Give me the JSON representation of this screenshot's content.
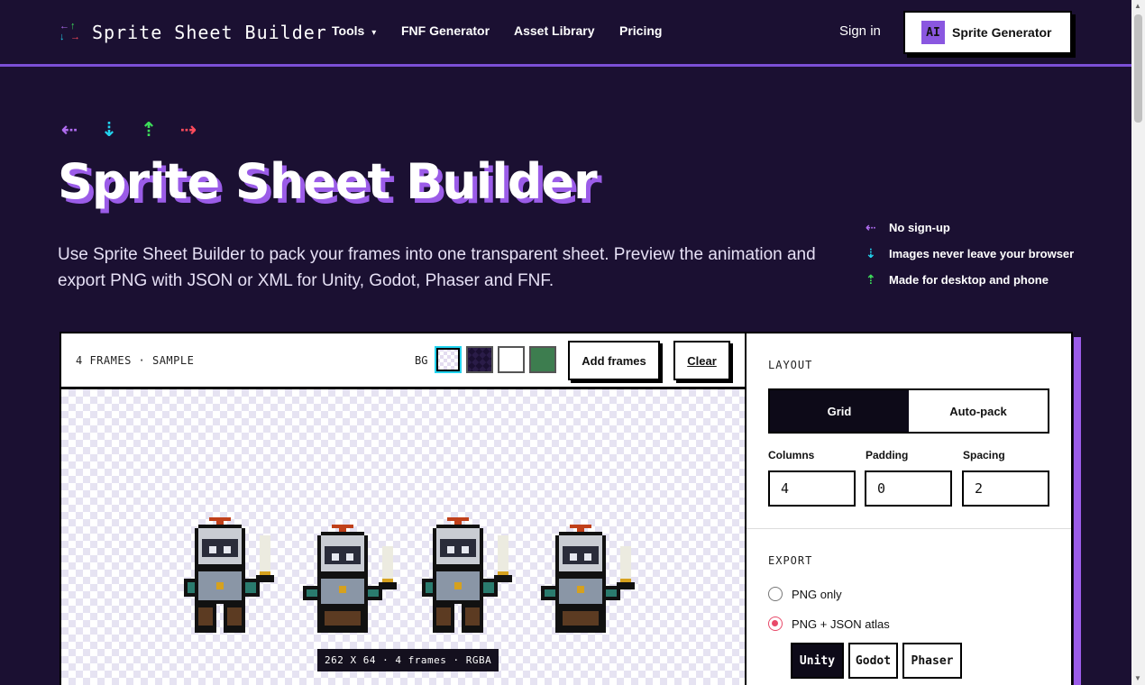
{
  "nav": {
    "logo_text": "Sprite Sheet Builder",
    "links": [
      {
        "label": "Tools",
        "dropdown": true
      },
      {
        "label": "FNF Generator"
      },
      {
        "label": "Asset Library"
      },
      {
        "label": "Pricing"
      }
    ],
    "dropdown_caret": "▾",
    "sign_in": "Sign in",
    "cta_badge": "AI",
    "cta_label": "Sprite Generator"
  },
  "hero": {
    "arrows": [
      {
        "glyph": "⇠",
        "icon": "left-arrow-icon",
        "color": "#b06cf0"
      },
      {
        "glyph": "⇣",
        "icon": "down-arrow-icon",
        "color": "#22d3ee"
      },
      {
        "glyph": "⇡",
        "icon": "up-arrow-icon",
        "color": "#3ddc5a"
      },
      {
        "glyph": "⇢",
        "icon": "right-arrow-icon",
        "color": "#ff4b5c"
      }
    ],
    "title": "Sprite Sheet Builder",
    "description": "Use Sprite Sheet Builder to pack your frames into one transparent sheet. Preview the animation and export PNG with JSON or XML for Unity, Godot, Phaser and FNF.",
    "features": [
      {
        "glyph": "⇠",
        "icon": "left-arrow-icon",
        "color": "#b06cf0",
        "text": "No sign-up"
      },
      {
        "glyph": "⇣",
        "icon": "down-arrow-icon",
        "color": "#22d3ee",
        "text": "Images never leave your browser"
      },
      {
        "glyph": "⇡",
        "icon": "up-arrow-icon",
        "color": "#3ddc5a",
        "text": "Made for desktop and phone"
      }
    ]
  },
  "tool": {
    "frames_label": "4 FRAMES · SAMPLE",
    "bg_label": "BG",
    "bg_swatches": [
      {
        "name": "checker",
        "color": "#efeaf7",
        "selected": true
      },
      {
        "name": "dark",
        "color": "#1b1032",
        "selected": false
      },
      {
        "name": "white",
        "color": "#ffffff",
        "selected": false
      },
      {
        "name": "green",
        "color": "#3d7d4f",
        "selected": false
      }
    ],
    "add_frames": "Add frames",
    "clear": "Clear",
    "sheet_info": "262 X 64 · 4 frames · RGBA"
  },
  "settings": {
    "layout_label": "LAYOUT",
    "layout_options": [
      {
        "label": "Grid",
        "selected": true
      },
      {
        "label": "Auto-pack",
        "selected": false
      }
    ],
    "fields": [
      {
        "label": "Columns",
        "value": "4"
      },
      {
        "label": "Padding",
        "value": "0"
      },
      {
        "label": "Spacing",
        "value": "2"
      }
    ],
    "export_label": "EXPORT",
    "export_options": [
      {
        "label": "PNG only",
        "selected": false
      },
      {
        "label": "PNG + JSON atlas",
        "selected": true
      }
    ],
    "engines": [
      {
        "label": "Unity",
        "selected": true
      },
      {
        "label": "Godot",
        "selected": false
      },
      {
        "label": "Phaser",
        "selected": false
      }
    ]
  },
  "colors": {
    "background": "#1b1032",
    "accent_purple": "#9b5ce8",
    "nav_border": "#7b4fd6",
    "radio_selected": "#e84a6a"
  }
}
